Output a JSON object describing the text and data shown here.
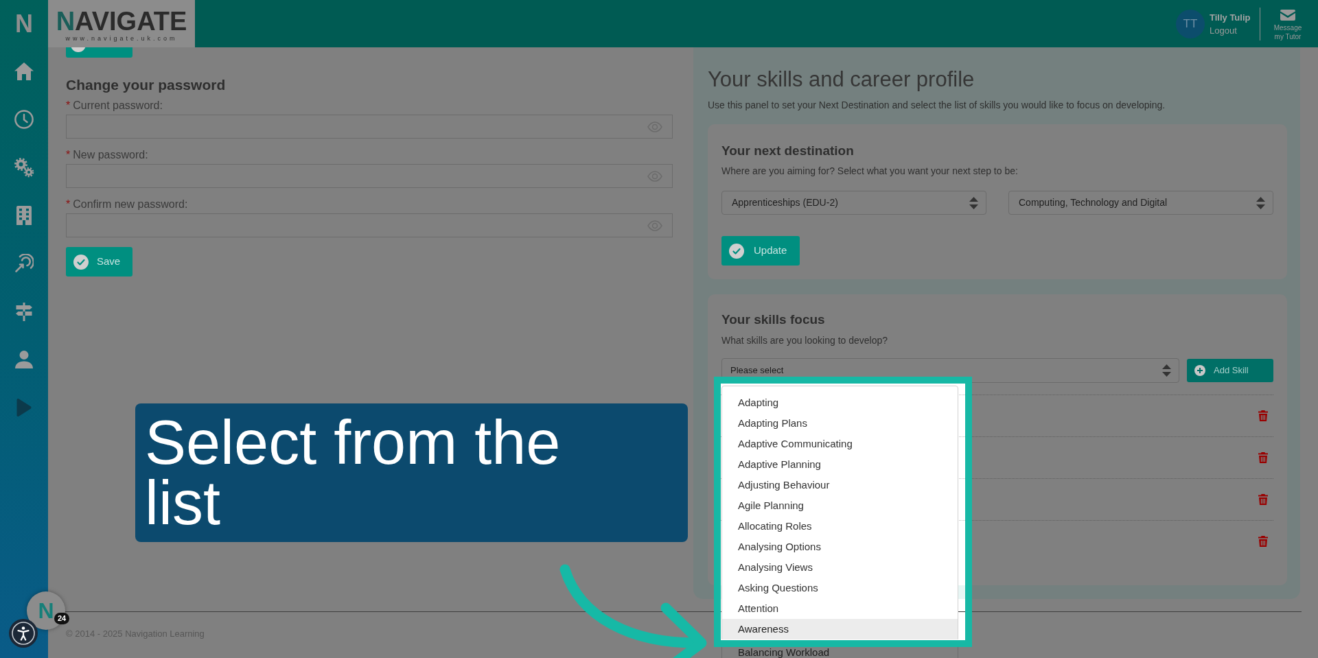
{
  "sidebar": {
    "logo": "N"
  },
  "header": {
    "logo": {
      "wordmark": "NAVIGATE",
      "url": "www.navigate.uk.com"
    },
    "user": {
      "initials": "TT",
      "name": "Tilly Tulip",
      "logout": "Logout"
    },
    "message_tutor": "Message my Tutor"
  },
  "password_form": {
    "title": "Change your password",
    "fields": [
      {
        "required_marker": "*",
        "label": "Current password:"
      },
      {
        "required_marker": "*",
        "label": "New password:"
      },
      {
        "required_marker": "*",
        "label": "Confirm new password:"
      }
    ],
    "save_button": "Save"
  },
  "profile_panel": {
    "title": "Your skills and career profile",
    "description": "Use this panel to set your Next Destination and select the list of skills you would like to focus on developing.",
    "next_destination": {
      "title": "Your next destination",
      "prompt": "Where are you aiming for? Select what you want your next step to be:",
      "selects": [
        {
          "value": "Apprenticeships (EDU-2)"
        },
        {
          "value": "Computing, Technology and Digital"
        }
      ],
      "update_button": "Update"
    },
    "skills_focus": {
      "title": "Your skills focus",
      "prompt": "What skills are you looking to develop?",
      "skill_select": {
        "value": "Please select"
      },
      "add_button": "Add Skill",
      "rows": [
        {
          "kind": "skill"
        },
        {
          "kind": "skill"
        },
        {
          "kind": "skill"
        },
        {
          "kind": "skill"
        }
      ]
    }
  },
  "skill_dropdown": {
    "options": [
      {
        "label": "Adapting",
        "selected": false
      },
      {
        "label": "Adapting Plans",
        "selected": false
      },
      {
        "label": "Adaptive Communicating",
        "selected": false
      },
      {
        "label": "Adaptive Planning",
        "selected": false
      },
      {
        "label": "Adjusting Behaviour",
        "selected": false
      },
      {
        "label": "Agile Planning",
        "selected": false
      },
      {
        "label": "Allocating Roles",
        "selected": false
      },
      {
        "label": "Analysing Options",
        "selected": false
      },
      {
        "label": "Analysing Views",
        "selected": false
      },
      {
        "label": "Asking Questions",
        "selected": false
      },
      {
        "label": "Attention",
        "selected": false
      },
      {
        "label": "Awareness",
        "selected": true
      },
      {
        "label": "Balancing Workload",
        "selected": false
      }
    ]
  },
  "footer": {
    "copyright": "© 2014 - 2025 Navigation Learning"
  },
  "chat_widget": {
    "logo": "N",
    "badge": "24"
  },
  "tutorial": {
    "callout": "Select from the list"
  }
}
